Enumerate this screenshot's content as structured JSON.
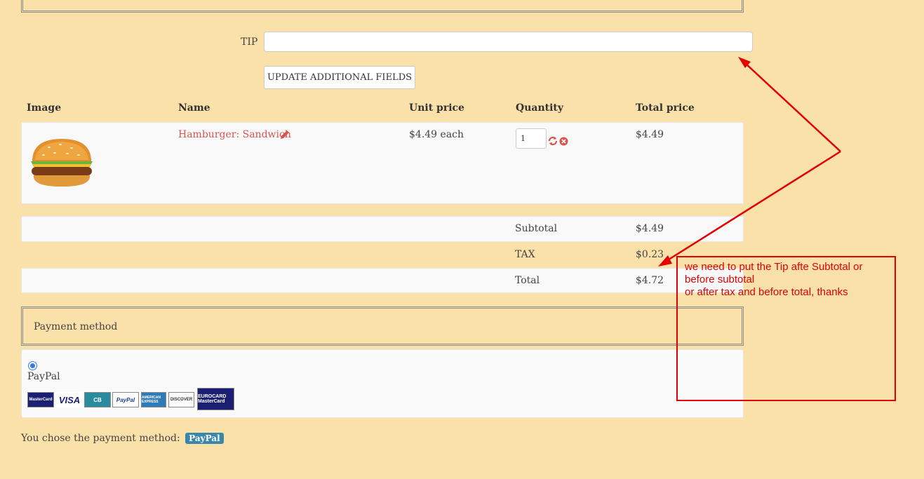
{
  "tip": {
    "label": "TIP",
    "value": "",
    "placeholder": ""
  },
  "update_button": "UPDATE ADDITIONAL FIELDS",
  "table": {
    "headers": [
      "Image",
      "Name",
      "Unit price",
      "Quantity",
      "Total price"
    ],
    "rows": [
      {
        "name": "Hamburger: Sandwich",
        "unit_price": "$4.49 each",
        "quantity": "1",
        "total": "$4.49"
      }
    ]
  },
  "totals": {
    "subtotal_label": "Subtotal",
    "subtotal_value": "$4.49",
    "tax_label": "TAX",
    "tax_value": "$0.23",
    "total_label": "Total",
    "total_value": "$4.72"
  },
  "payment": {
    "title": "Payment method",
    "option": "PayPal",
    "cards": [
      "MasterCard",
      "VISA",
      "CB",
      "PayPal",
      "AMERICAN EXPRESS",
      "DISCOVER",
      "EUROCARD MasterCard"
    ],
    "chosen_text": "You chose the payment method:",
    "chosen_value": "PayPal"
  },
  "annotation": {
    "line1": "we need to put the Tip afte Subtotal or before subtotal",
    "line2": "or after tax and before total, thanks",
    "color": "#e50000"
  },
  "colors": {
    "background": "#fae0a9",
    "link": "#d9534f",
    "badge": "#3a87ad"
  },
  "icons": [
    "burger-image",
    "pencil-icon",
    "refresh-icon",
    "remove-icon"
  ]
}
